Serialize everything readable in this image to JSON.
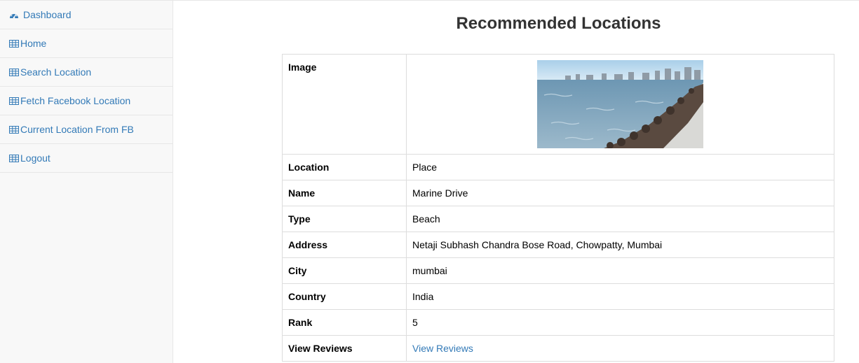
{
  "sidebar": {
    "items": [
      {
        "label": "Dashboard",
        "icon": "dashboard-icon"
      },
      {
        "label": "Home",
        "icon": "table-icon"
      },
      {
        "label": "Search Location",
        "icon": "table-icon"
      },
      {
        "label": "Fetch Facebook Location",
        "icon": "table-icon"
      },
      {
        "label": "Current Location From FB",
        "icon": "table-icon"
      },
      {
        "label": "Logout",
        "icon": "table-icon"
      }
    ]
  },
  "main": {
    "title": "Recommended Locations",
    "details": [
      {
        "label": "Image",
        "value": ""
      },
      {
        "label": "Location",
        "value": "Place"
      },
      {
        "label": "Name",
        "value": "Marine Drive"
      },
      {
        "label": "Type",
        "value": "Beach"
      },
      {
        "label": "Address",
        "value": "Netaji Subhash Chandra Bose Road, Chowpatty, Mumbai"
      },
      {
        "label": "City",
        "value": "mumbai"
      },
      {
        "label": "Country",
        "value": "India"
      },
      {
        "label": "Rank",
        "value": "5"
      },
      {
        "label": "View Reviews",
        "value": "View Reviews"
      }
    ]
  },
  "colors": {
    "link": "#337ab7",
    "sidebar_bg": "#f8f8f8",
    "border": "#dddddd"
  }
}
